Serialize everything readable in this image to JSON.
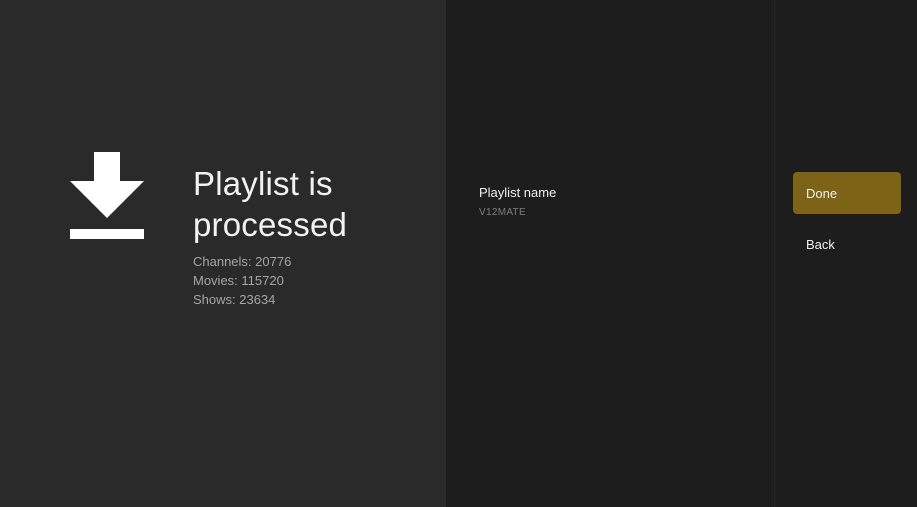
{
  "processing": {
    "icon": "download-icon",
    "title": "Playlist is processed",
    "channels": "Channels: 20776",
    "movies": "Movies: 115720",
    "shows": "Shows: 23634"
  },
  "playlist": {
    "name_label": "Playlist name",
    "name_value": "V12MATE"
  },
  "actions": {
    "done_label": "Done",
    "back_label": "Back"
  },
  "colors": {
    "left_bg": "#2a2a2a",
    "panel_bg": "#1d1d1d",
    "accent": "#7c6316"
  }
}
